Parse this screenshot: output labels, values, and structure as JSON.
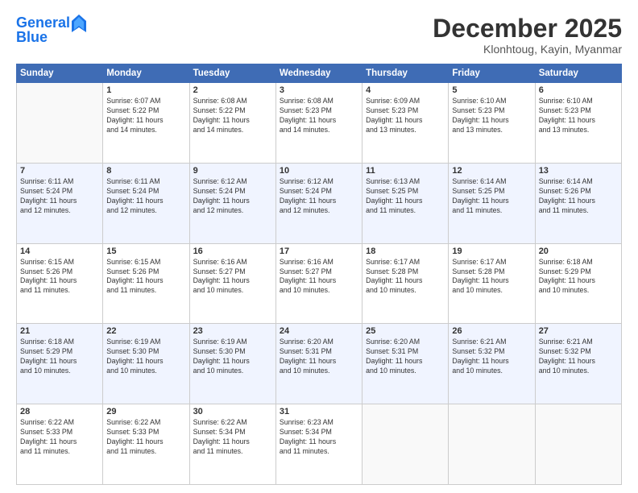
{
  "header": {
    "logo_line1": "General",
    "logo_line2": "Blue",
    "month_title": "December 2025",
    "location": "Klonhtoug, Kayin, Myanmar"
  },
  "days_of_week": [
    "Sunday",
    "Monday",
    "Tuesday",
    "Wednesday",
    "Thursday",
    "Friday",
    "Saturday"
  ],
  "weeks": [
    [
      {
        "day": "",
        "text": ""
      },
      {
        "day": "1",
        "text": "Sunrise: 6:07 AM\nSunset: 5:22 PM\nDaylight: 11 hours\nand 14 minutes."
      },
      {
        "day": "2",
        "text": "Sunrise: 6:08 AM\nSunset: 5:22 PM\nDaylight: 11 hours\nand 14 minutes."
      },
      {
        "day": "3",
        "text": "Sunrise: 6:08 AM\nSunset: 5:23 PM\nDaylight: 11 hours\nand 14 minutes."
      },
      {
        "day": "4",
        "text": "Sunrise: 6:09 AM\nSunset: 5:23 PM\nDaylight: 11 hours\nand 13 minutes."
      },
      {
        "day": "5",
        "text": "Sunrise: 6:10 AM\nSunset: 5:23 PM\nDaylight: 11 hours\nand 13 minutes."
      },
      {
        "day": "6",
        "text": "Sunrise: 6:10 AM\nSunset: 5:23 PM\nDaylight: 11 hours\nand 13 minutes."
      }
    ],
    [
      {
        "day": "7",
        "text": "Sunrise: 6:11 AM\nSunset: 5:24 PM\nDaylight: 11 hours\nand 12 minutes."
      },
      {
        "day": "8",
        "text": "Sunrise: 6:11 AM\nSunset: 5:24 PM\nDaylight: 11 hours\nand 12 minutes."
      },
      {
        "day": "9",
        "text": "Sunrise: 6:12 AM\nSunset: 5:24 PM\nDaylight: 11 hours\nand 12 minutes."
      },
      {
        "day": "10",
        "text": "Sunrise: 6:12 AM\nSunset: 5:24 PM\nDaylight: 11 hours\nand 12 minutes."
      },
      {
        "day": "11",
        "text": "Sunrise: 6:13 AM\nSunset: 5:25 PM\nDaylight: 11 hours\nand 11 minutes."
      },
      {
        "day": "12",
        "text": "Sunrise: 6:14 AM\nSunset: 5:25 PM\nDaylight: 11 hours\nand 11 minutes."
      },
      {
        "day": "13",
        "text": "Sunrise: 6:14 AM\nSunset: 5:26 PM\nDaylight: 11 hours\nand 11 minutes."
      }
    ],
    [
      {
        "day": "14",
        "text": "Sunrise: 6:15 AM\nSunset: 5:26 PM\nDaylight: 11 hours\nand 11 minutes."
      },
      {
        "day": "15",
        "text": "Sunrise: 6:15 AM\nSunset: 5:26 PM\nDaylight: 11 hours\nand 11 minutes."
      },
      {
        "day": "16",
        "text": "Sunrise: 6:16 AM\nSunset: 5:27 PM\nDaylight: 11 hours\nand 10 minutes."
      },
      {
        "day": "17",
        "text": "Sunrise: 6:16 AM\nSunset: 5:27 PM\nDaylight: 11 hours\nand 10 minutes."
      },
      {
        "day": "18",
        "text": "Sunrise: 6:17 AM\nSunset: 5:28 PM\nDaylight: 11 hours\nand 10 minutes."
      },
      {
        "day": "19",
        "text": "Sunrise: 6:17 AM\nSunset: 5:28 PM\nDaylight: 11 hours\nand 10 minutes."
      },
      {
        "day": "20",
        "text": "Sunrise: 6:18 AM\nSunset: 5:29 PM\nDaylight: 11 hours\nand 10 minutes."
      }
    ],
    [
      {
        "day": "21",
        "text": "Sunrise: 6:18 AM\nSunset: 5:29 PM\nDaylight: 11 hours\nand 10 minutes."
      },
      {
        "day": "22",
        "text": "Sunrise: 6:19 AM\nSunset: 5:30 PM\nDaylight: 11 hours\nand 10 minutes."
      },
      {
        "day": "23",
        "text": "Sunrise: 6:19 AM\nSunset: 5:30 PM\nDaylight: 11 hours\nand 10 minutes."
      },
      {
        "day": "24",
        "text": "Sunrise: 6:20 AM\nSunset: 5:31 PM\nDaylight: 11 hours\nand 10 minutes."
      },
      {
        "day": "25",
        "text": "Sunrise: 6:20 AM\nSunset: 5:31 PM\nDaylight: 11 hours\nand 10 minutes."
      },
      {
        "day": "26",
        "text": "Sunrise: 6:21 AM\nSunset: 5:32 PM\nDaylight: 11 hours\nand 10 minutes."
      },
      {
        "day": "27",
        "text": "Sunrise: 6:21 AM\nSunset: 5:32 PM\nDaylight: 11 hours\nand 10 minutes."
      }
    ],
    [
      {
        "day": "28",
        "text": "Sunrise: 6:22 AM\nSunset: 5:33 PM\nDaylight: 11 hours\nand 11 minutes."
      },
      {
        "day": "29",
        "text": "Sunrise: 6:22 AM\nSunset: 5:33 PM\nDaylight: 11 hours\nand 11 minutes."
      },
      {
        "day": "30",
        "text": "Sunrise: 6:22 AM\nSunset: 5:34 PM\nDaylight: 11 hours\nand 11 minutes."
      },
      {
        "day": "31",
        "text": "Sunrise: 6:23 AM\nSunset: 5:34 PM\nDaylight: 11 hours\nand 11 minutes."
      },
      {
        "day": "",
        "text": ""
      },
      {
        "day": "",
        "text": ""
      },
      {
        "day": "",
        "text": ""
      }
    ]
  ]
}
